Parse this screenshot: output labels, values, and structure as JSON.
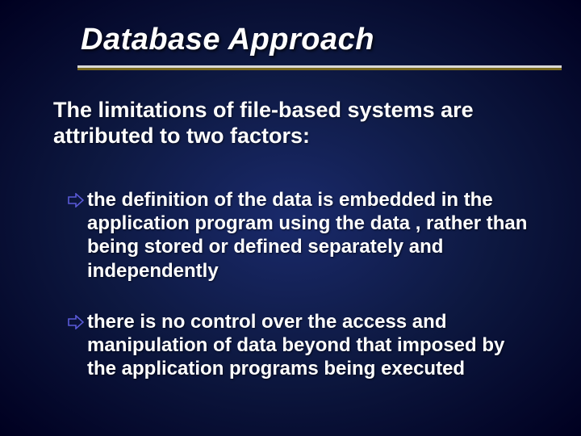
{
  "slide": {
    "title": "Database Approach",
    "intro": "The limitations of file-based systems are attributed to two factors:",
    "bullets": [
      "the definition of the data is embedded in the application program using the data , rather than being stored or defined separately and independently",
      "there is no control over the access and manipulation of data beyond that imposed by the application programs being executed"
    ]
  }
}
